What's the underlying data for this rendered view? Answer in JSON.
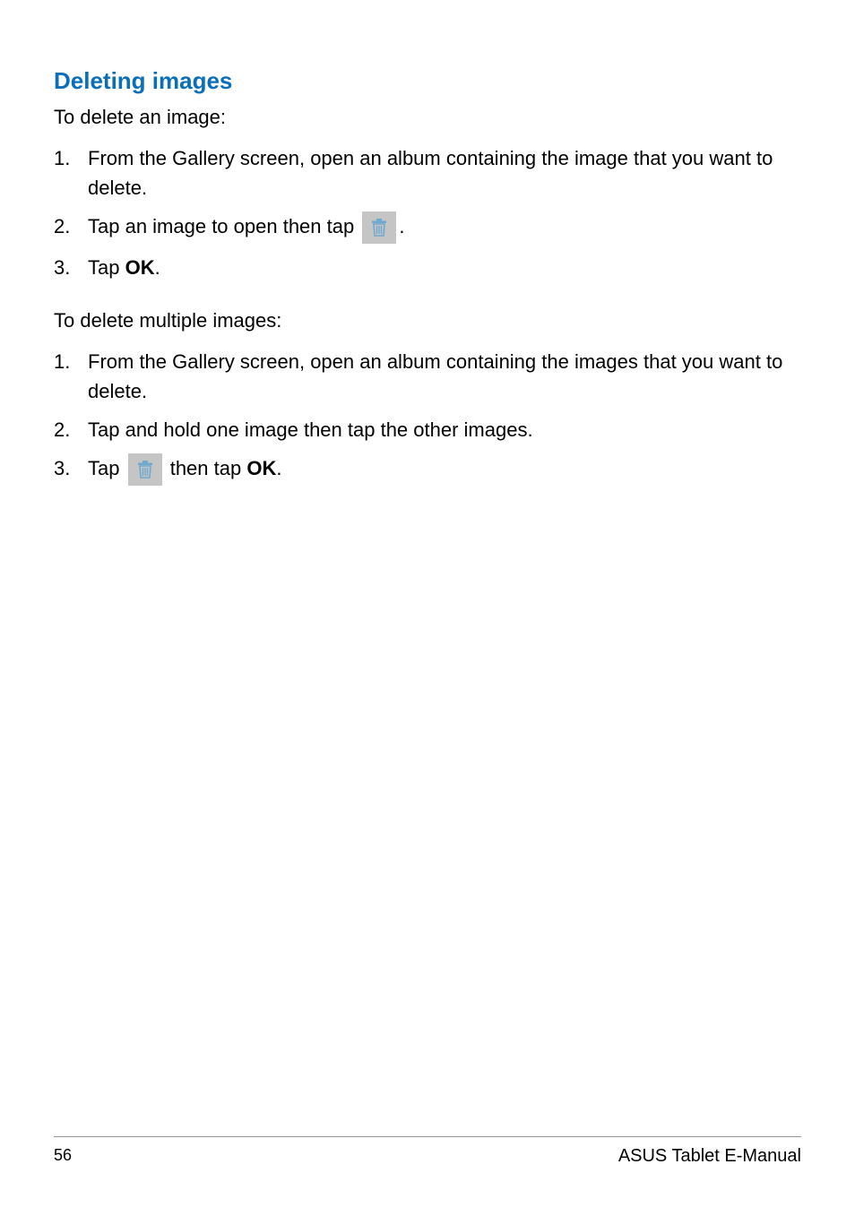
{
  "heading": "Deleting images",
  "section1": {
    "intro": "To delete an image:",
    "items": [
      {
        "num": "1.",
        "text": "From the Gallery screen, open an album containing the image that you want to delete."
      },
      {
        "num": "2.",
        "pre": "Tap an image to open then tap ",
        "post": "."
      },
      {
        "num": "3.",
        "pre": "Tap ",
        "bold": "OK",
        "post": "."
      }
    ]
  },
  "section2": {
    "intro": "To delete multiple images:",
    "items": [
      {
        "num": "1.",
        "text": "From the Gallery screen, open an album containing the images that you want to delete."
      },
      {
        "num": "2.",
        "text": "Tap and hold one image then tap the other images."
      },
      {
        "num": "3.",
        "pre": "Tap ",
        "mid": " then tap ",
        "bold": "OK",
        "post": "."
      }
    ]
  },
  "footer": {
    "page": "56",
    "title": "ASUS Tablet E-Manual"
  }
}
